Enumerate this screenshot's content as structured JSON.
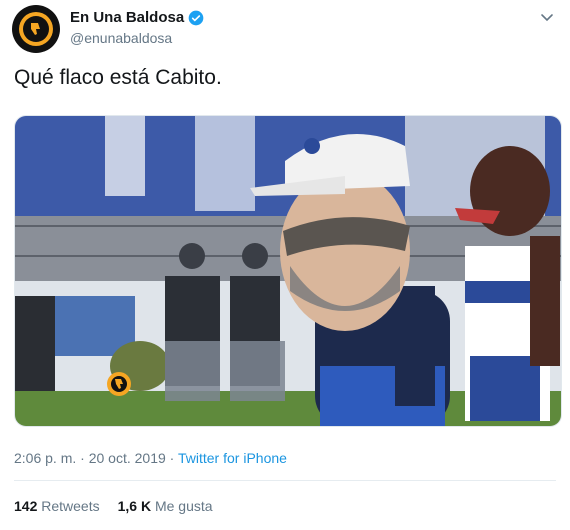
{
  "account": {
    "display_name": "En Una Baldosa",
    "handle": "@enunabaldosa",
    "verified": true,
    "avatar_icon": "thumbs-down-logo-icon",
    "brand_color": "#f5a623"
  },
  "tweet": {
    "text": "Qué flaco está Cabito.",
    "media_alt_icon": "photo-image"
  },
  "meta": {
    "time": "2:06 p. m.",
    "separator1": " · ",
    "date": "20 oct. 2019",
    "separator2": " · ",
    "source": "Twitter for iPhone"
  },
  "stats": {
    "retweets_count": "142",
    "retweets_label": "Retweets",
    "likes_count": "1,6 K",
    "likes_label": "Me gusta"
  },
  "colors": {
    "link": "#1b95e0",
    "secondary_text": "#657786",
    "verified": "#1da1f2"
  }
}
